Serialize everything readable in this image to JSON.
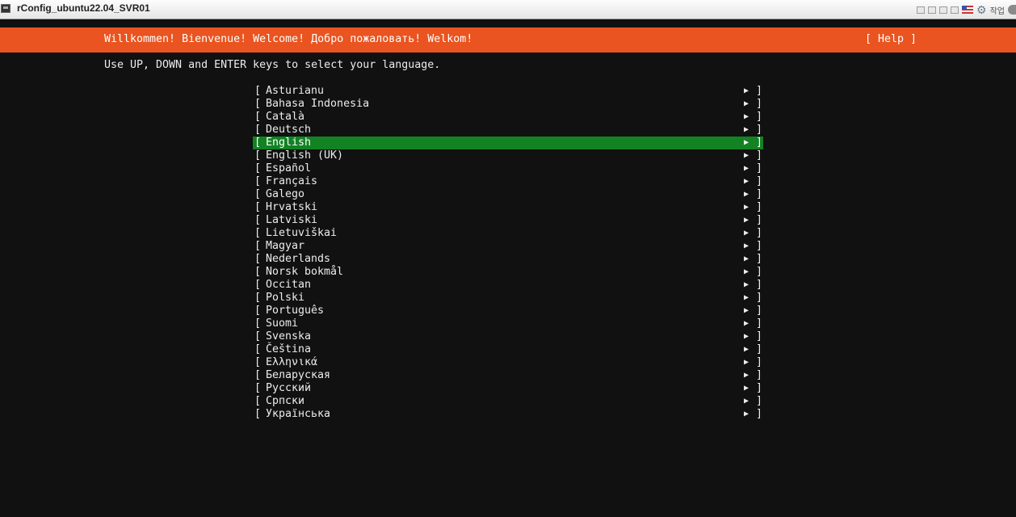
{
  "window": {
    "title": "rConfig_ubuntu22.04_SVR01",
    "work_label": "작업"
  },
  "installer": {
    "header": {
      "title": "Willkommen! Bienvenue! Welcome! Добро пожаловать! Welkom!",
      "help_label": "[ Help ]"
    },
    "instructions": "Use UP, DOWN and ENTER keys to select your language.",
    "bracket_open": "[",
    "bracket_close": "]",
    "arrow_glyph": "▶",
    "selected_language": "English",
    "languages": [
      "Asturianu",
      "Bahasa Indonesia",
      "Català",
      "Deutsch",
      "English",
      "English (UK)",
      "Español",
      "Français",
      "Galego",
      "Hrvatski",
      "Latviski",
      "Lietuviškai",
      "Magyar",
      "Nederlands",
      "Norsk bokmål",
      "Occitan",
      "Polski",
      "Português",
      "Suomi",
      "Svenska",
      "Čeština",
      "Ελληνικά",
      "Беларуская",
      "Русский",
      "Српски",
      "Українська"
    ]
  },
  "colors": {
    "header_bg": "#e95420",
    "selected_bg": "#128223",
    "console_bg": "#111111",
    "text": "#ececec"
  }
}
